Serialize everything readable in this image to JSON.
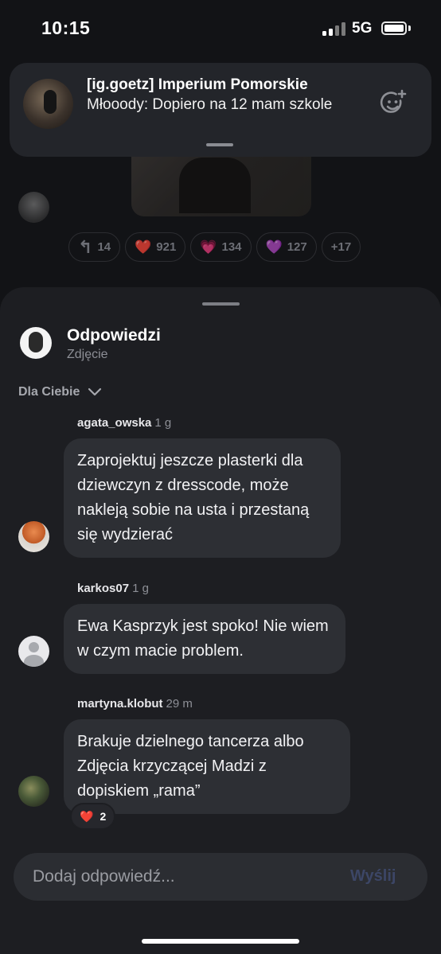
{
  "status_bar": {
    "time": "10:15",
    "network": "5G"
  },
  "background_thread": {
    "reactions": [
      {
        "icon": "reply-icon",
        "glyph": "↰",
        "count": "14"
      },
      {
        "icon": "red-heart-icon",
        "glyph": "❤️",
        "count": "921"
      },
      {
        "icon": "sparkling-heart-icon",
        "glyph": "💗",
        "count": "134"
      },
      {
        "icon": "purple-heart-icon",
        "glyph": "💜",
        "count": "127"
      },
      {
        "icon": "more-reactions",
        "glyph": "",
        "count": "+17"
      }
    ]
  },
  "notification": {
    "title": "[ig.goetz] Imperium Pomorskie",
    "body": "Młooody: Dopiero na 12 mam szkole"
  },
  "sheet": {
    "title": "Odpowiedzi",
    "subtitle": "Zdjęcie",
    "filter_label": "Dla Ciebie"
  },
  "comments": [
    {
      "author": "agata_owska",
      "ago": "1 g",
      "text": "Zaprojektuj jeszcze plasterki dla dziewczyn z dresscode, może nakleją sobie na usta i przestaną się wydzierać"
    },
    {
      "author": "karkos07",
      "ago": "1 g",
      "text": "Ewa Kasprzyk jest spoko! Nie wiem w czym macie problem."
    },
    {
      "author": "martyna.klobut",
      "ago": "29 m",
      "text": "Brakuje dzielnego tancerza albo Zdjęcia krzyczącej Madzi z dopiskiem „rama”",
      "reaction": {
        "emoji": "❤️",
        "count": "2"
      }
    }
  ],
  "composer": {
    "placeholder": "Dodaj odpowiedź...",
    "send_label": "Wyślij"
  },
  "colors": {
    "sheet_bg": "#1d1e22",
    "bubble_bg": "#2d2f34",
    "send_disabled": "#3c4666"
  }
}
